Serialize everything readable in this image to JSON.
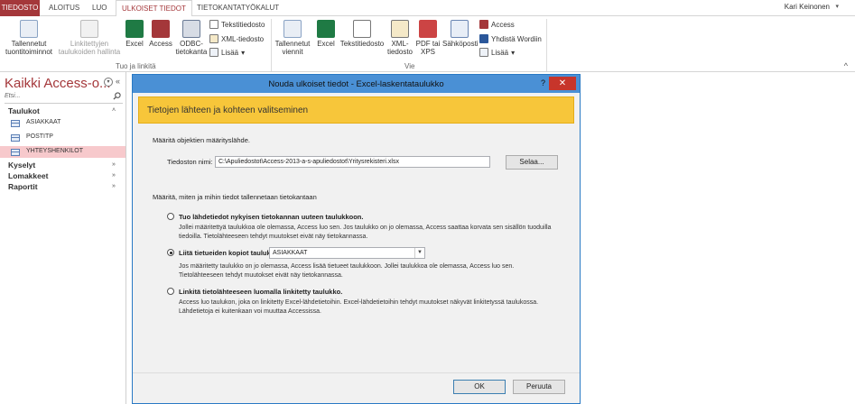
{
  "tabs": [
    {
      "label": "TIEDOSTO"
    },
    {
      "label": "ALOITUS"
    },
    {
      "label": "LUO"
    },
    {
      "label": "ULKOISET TIEDOT"
    },
    {
      "label": "TIETOKANTATYÖKALUT"
    }
  ],
  "user": {
    "name": "Kari Keinonen"
  },
  "ribbon": {
    "import_group": {
      "label": "Tuo ja linkitä",
      "saved_imports": "Tallennetut tuontitoiminnot",
      "linked_table_manager": "Linkitettyjen taulukoiden hallinta",
      "excel": "Excel",
      "access": "Access",
      "odbc": "ODBC-tietokanta",
      "text_file": "Tekstitiedosto",
      "xml_file": "XML-tiedosto",
      "more": "Lisää"
    },
    "export_group": {
      "label": "Vie",
      "saved_exports": "Tallennetut viennit",
      "excel": "Excel",
      "text_file": "Tekstitiedosto",
      "xml_file": "XML-tiedosto",
      "pdf_xps": "PDF tai XPS",
      "email": "Sähköposti",
      "access": "Access",
      "word_merge": "Yhdistä Wordiin",
      "more": "Lisää"
    }
  },
  "nav": {
    "title": "Kaikki Access-o...",
    "search_placeholder": "Etsi...",
    "sections": {
      "tables": "Taulukot",
      "queries": "Kyselyt",
      "forms": "Lomakkeet",
      "reports": "Raportit"
    },
    "tables": [
      "ASIAKKAAT",
      "POSTITP",
      "YHTEYSHENKILOT"
    ]
  },
  "dialog": {
    "title": "Nouda ulkoiset tiedot - Excel-laskentataulukko",
    "help": "?",
    "close": "✕",
    "banner": "Tietojen lähteen ja kohteen valitseminen",
    "source_prompt": "Määritä objektien määrityslähde.",
    "file_label": "Tiedoston nimi:",
    "file_value": "C:\\Apuliedostot\\Access-2013-a-s-apuliedostot\\Yritysrekisteri.xlsx",
    "browse": "Selaa...",
    "storage_prompt": "Määritä, miten ja mihin tiedot tallennetaan tietokantaan",
    "option1_title": "Tuo lähdetiedot nykyisen tietokannan uuteen taulukkoon.",
    "option1_desc": "Jollei määritettyä taulukkoa ole olemassa, Access luo sen. Jos taulukko on jo olemassa, Access saattaa korvata sen sisällön tuoduilla tiedoilla. Tietolähteeseen tehdyt muutokset eivät näy tietokannassa.",
    "option2_title": "Liitä tietueiden kopiot taulukkoon:",
    "option2_select": "ASIAKKAAT",
    "option2_desc": "Jos määritetty taulukko on jo olemassa, Access lisää tietueet taulukkoon. Jollei taulukkoa ole olemassa, Access luo sen. Tietolähteeseen tehdyt muutokset eivät näy tietokannassa.",
    "option3_title": "Linkitä tietolähteeseen luomalla linkitetty taulukko.",
    "option3_desc": "Access luo taulukon, joka on linkitetty Excel-lähdetietoihin. Excel-lähdetietoihin tehdyt muutokset näkyvät linkitetyssä taulukossa. Lähdetietoja ei kuitenkaan voi muuttaa Accessissa.",
    "selected_option": 2,
    "ok": "OK",
    "cancel": "Peruuta"
  },
  "colors": {
    "accent": "#a4373a",
    "dialog_title": "#4a90d5",
    "banner": "#f7c63a",
    "close": "#c7352b",
    "selected_nav": "#f7c9cc"
  }
}
